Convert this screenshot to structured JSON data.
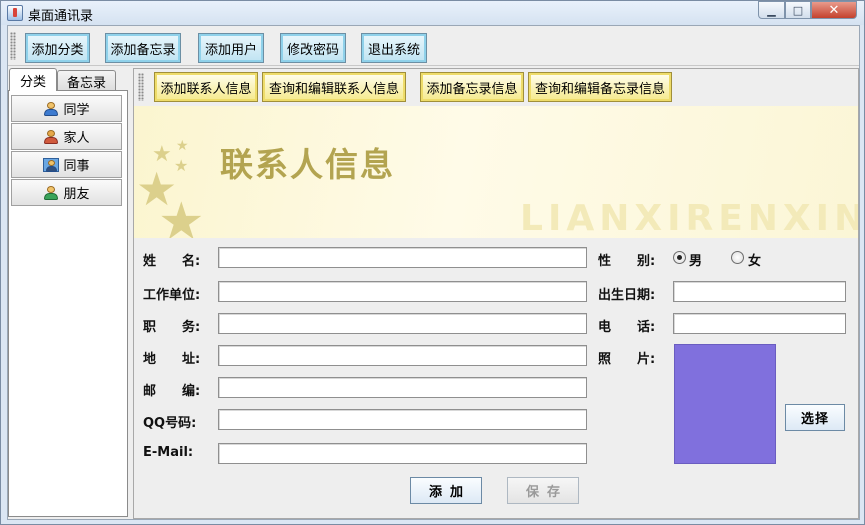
{
  "window": {
    "title": "桌面通讯录"
  },
  "toolbar": {
    "buttons": [
      "添加分类",
      "添加备忘录",
      "添加用户",
      "修改密码",
      "退出系统"
    ]
  },
  "left_tabs": {
    "tabs": [
      "分类",
      "备忘录"
    ],
    "active_tab": "分类",
    "categories": [
      {
        "label": "同学",
        "icon": "classmate-icon"
      },
      {
        "label": "家人",
        "icon": "family-icon"
      },
      {
        "label": "同事",
        "icon": "colleague-icon"
      },
      {
        "label": "朋友",
        "icon": "friend-icon"
      }
    ]
  },
  "subtoolbar": {
    "buttons": [
      "添加联系人信息",
      "查询和编辑联系人信息",
      "添加备忘录信息",
      "查询和编辑备忘录信息"
    ]
  },
  "banner": {
    "title": "联系人信息",
    "subtitle": "LIANXIRENXINXI"
  },
  "form": {
    "labels": {
      "name": "姓　　名:",
      "company": "工作单位:",
      "position": "职　　务:",
      "address": "地　　址:",
      "postcode": "邮　　编:",
      "qq": "QQ号码:",
      "email": "E-Mail:",
      "gender": "性　　别:",
      "birthday": "出生日期:",
      "phone": "电　　话:",
      "photo": "照　　片:"
    },
    "gender_options": [
      "男",
      "女"
    ],
    "gender_selected": "男",
    "select_button": "选择",
    "add_button": "添加",
    "save_button": "保存",
    "colors": {
      "photo_placeholder": "#8070dd",
      "banner_title": "#b3a450"
    }
  }
}
